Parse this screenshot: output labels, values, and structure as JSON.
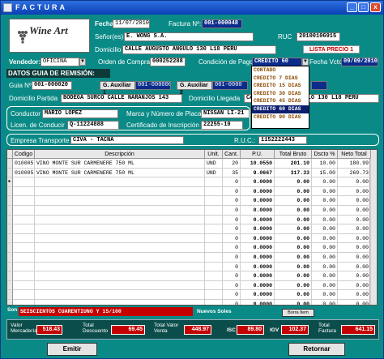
{
  "window": {
    "title": "FACTURA",
    "minimize": "_",
    "maximize": "□",
    "close": "x"
  },
  "logo": {
    "text": "Wine Art"
  },
  "header": {
    "fecha_label": "Fecha:",
    "fecha": "11/07/2010",
    "factura_label": "Factura Nº:",
    "factura": "001-000048",
    "senores_label": "Señor(es):",
    "senores": "E. WONG S.A.",
    "ruc_label": "RUC",
    "ruc": "20100106915",
    "domicilio_label": "Domicilio",
    "domicilio": "CALLE AUGUSTO ANGULO 130 L18 PERU",
    "lista": "LISTA PRECIO 1",
    "vendedor_label": "Vendedor:",
    "vendedor": "OFICINA",
    "orden_label": "Orden de Compra",
    "orden": "000252288",
    "condicion_label": "Condición de Pago",
    "condicion": "CREDITO 60",
    "vcto_label": "Fecha Vcto.",
    "vcto": "09/09/2010"
  },
  "condicion_options": [
    "CONTADO",
    "CREDITO 7 DIAS",
    "CREDITO 15 DIAS",
    "CREDITO 30 DIAS",
    "CREDITO 45 DIAS",
    "CREDITO 60 DIAS",
    "CREDITO 90 DIAS"
  ],
  "guia": {
    "section_title": "DATOS GUIA DE REMISIÓN:",
    "guia_label": "Guia Nº",
    "guia": "001-000020",
    "aux1_label": "G. Auxiliar 1",
    "aux1": "001-000000",
    "aux2_label": "G. Auxiliar 2",
    "aux2": "001-0000",
    "partida_label": "Domicilio Partida",
    "partida": "BODEGA SURCO CALLE NARANJOS 143",
    "llegada_label": "Domicilio Llegada",
    "llegada": "CALLE AUGUSTO ANGULO 130 L18 PERU",
    "conductor_label": "Conductor",
    "conductor": "MARIO LOPEZ",
    "placa_label": "Marca y Número de Placa",
    "placa": "NISSAN LI-21",
    "licencia_label": "Licen. de Conducir",
    "licencia": "Q-11224888",
    "certificado_label": "Certificado de Inscripción",
    "certificado": "22255-10",
    "empresa_label": "Empresa Transporte",
    "empresa": "CIVA - TACNA",
    "ruc_label": "R.U.C.:",
    "ruc": "1152222443"
  },
  "table": {
    "headers": [
      "Codigo",
      "Descripción",
      "Unit.",
      "Cant.",
      "P.U.",
      "Total Bruto",
      "Dscto %",
      "Neto Total"
    ],
    "rows": [
      [
        "010005",
        "VINO MONTE SUR CARMENERE 750 ML",
        "UND",
        "20",
        "10.0550",
        "201.10",
        "10.00",
        "180.99"
      ],
      [
        "010005",
        "VINO MONTE SUR CARMENERE 750 ML",
        "UND",
        "35",
        "9.0667",
        "317.33",
        "15.00",
        "269.73"
      ],
      [
        "",
        "",
        "",
        "0",
        "0.0000",
        "0.00",
        "0.00",
        "0.00"
      ],
      [
        "",
        "",
        "",
        "0",
        "0.0000",
        "0.00",
        "0.00",
        "0.00"
      ],
      [
        "",
        "",
        "",
        "0",
        "0.0000",
        "0.00",
        "0.00",
        "0.00"
      ],
      [
        "",
        "",
        "",
        "0",
        "0.0000",
        "0.00",
        "0.00",
        "0.00"
      ],
      [
        "",
        "",
        "",
        "0",
        "0.0000",
        "0.00",
        "0.00",
        "0.00"
      ],
      [
        "",
        "",
        "",
        "0",
        "0.0000",
        "0.00",
        "0.00",
        "0.00"
      ],
      [
        "",
        "",
        "",
        "0",
        "0.0000",
        "0.00",
        "0.00",
        "0.00"
      ],
      [
        "",
        "",
        "",
        "0",
        "0.0000",
        "0.00",
        "0.00",
        "0.00"
      ],
      [
        "",
        "",
        "",
        "0",
        "0.0000",
        "0.00",
        "0.00",
        "0.00"
      ],
      [
        "",
        "",
        "",
        "0",
        "0.0000",
        "0.00",
        "0.00",
        "0.00"
      ],
      [
        "",
        "",
        "",
        "0",
        "0.0000",
        "0.00",
        "0.00",
        "0.00"
      ],
      [
        "",
        "",
        "",
        "0",
        "0.0000",
        "0.00",
        "0.00",
        "0.00"
      ],
      [
        "",
        "",
        "",
        "0",
        "0.0000",
        "0.00",
        "0.00",
        "0.00"
      ],
      [
        "",
        "",
        "",
        "0",
        "0.0000",
        "0.00",
        "0.00",
        "0.00"
      ]
    ]
  },
  "footer": {
    "son_label": "Son",
    "son": "SEISCIENTOS CUARENTIUNO Y 15/100",
    "moneda": "Nuevos Soles",
    "borrar": "Borra Item",
    "valor_mercaderia_label": "Valor Mercadería",
    "valor_mercaderia": "518.43",
    "total_descuento_label": "Total Descuento",
    "total_descuento": "69.45",
    "total_valor_venta_label": "Total Valor Venta",
    "total_valor_venta": "448.97",
    "isc_label": "ISC",
    "isc": "89.80",
    "igv_label": "IGV",
    "igv": "102.37",
    "total_factura_label": "Total Factura",
    "total_factura": "641.15",
    "emitir": "Emitir",
    "retornar": "Retornar"
  },
  "colors": {
    "panel": "#0a8a86",
    "accent_red": "#c40000",
    "title_blue": "#0a3fb4"
  }
}
